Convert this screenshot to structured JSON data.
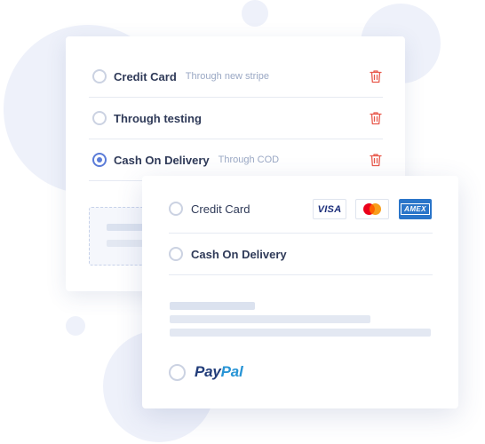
{
  "back_card": {
    "options": [
      {
        "label": "Credit Card",
        "sub": "Through new stripe",
        "selected": false,
        "icon": "trash-icon"
      },
      {
        "label": "Through testing",
        "sub": "",
        "selected": false,
        "icon": "trash-icon"
      },
      {
        "label": "Cash On Delivery",
        "sub": "Through COD",
        "selected": true,
        "icon": "trash-icon"
      }
    ]
  },
  "front_card": {
    "credit_card_label": "Credit Card",
    "cod_label": "Cash On Delivery",
    "card_logos": {
      "visa": "VISA",
      "mastercard": "mastercard-logo",
      "amex": "AMEX"
    },
    "paypal": {
      "part1": "Pay",
      "part2": "Pal"
    }
  },
  "colors": {
    "accent": "#5b7cd8",
    "trash": "#e8594c",
    "paypal_dark": "#223d7a",
    "paypal_light": "#2794d5",
    "amex_blue": "#2a75c9"
  }
}
